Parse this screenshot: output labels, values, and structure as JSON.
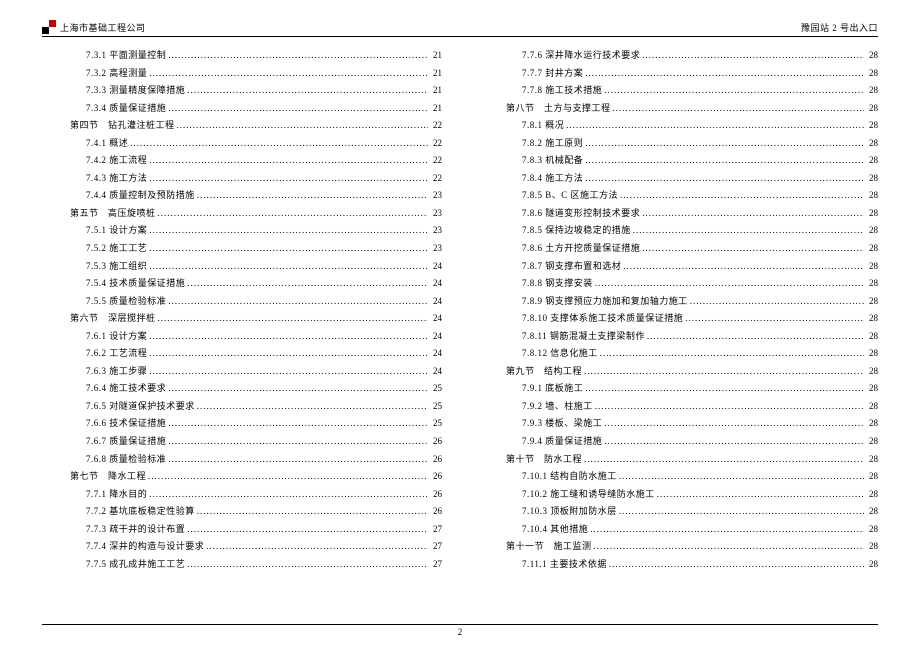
{
  "header": {
    "company": "上海市基础工程公司",
    "right": "豫园站 2 号出入口"
  },
  "footer": {
    "page_number": "2"
  },
  "toc": {
    "left": [
      {
        "indent": 1,
        "label": "7.3.1 平面测量控制",
        "page": "21"
      },
      {
        "indent": 1,
        "label": "7.3.2 高程测量",
        "page": "21"
      },
      {
        "indent": 1,
        "label": "7.3.3 测量精度保障措施",
        "page": "21"
      },
      {
        "indent": 1,
        "label": "7.3.4 质量保证措施",
        "page": "21"
      },
      {
        "indent": 0,
        "label": "第四节　钻孔灌注桩工程",
        "page": "22"
      },
      {
        "indent": 1,
        "label": "7.4.1 概述",
        "page": "22"
      },
      {
        "indent": 1,
        "label": "7.4.2 施工流程",
        "page": "22"
      },
      {
        "indent": 1,
        "label": "7.4.3 施工方法",
        "page": "22"
      },
      {
        "indent": 1,
        "label": "7.4.4 质量控制及预防措施",
        "page": "23"
      },
      {
        "indent": 0,
        "label": "第五节　高压旋喷桩",
        "page": "23"
      },
      {
        "indent": 1,
        "label": "7.5.1 设计方案",
        "page": "23"
      },
      {
        "indent": 1,
        "label": "7.5.2 施工工艺",
        "page": "23"
      },
      {
        "indent": 1,
        "label": "7.5.3 施工组织",
        "page": "24"
      },
      {
        "indent": 1,
        "label": "7.5.4 技术质量保证措施",
        "page": "24"
      },
      {
        "indent": 1,
        "label": "7.5.5 质量检验标准",
        "page": "24"
      },
      {
        "indent": 0,
        "label": "第六节　深层搅拌桩",
        "page": "24"
      },
      {
        "indent": 1,
        "label": "7.6.1 设计方案",
        "page": "24"
      },
      {
        "indent": 1,
        "label": "7.6.2 工艺流程",
        "page": "24"
      },
      {
        "indent": 1,
        "label": "7.6.3 施工步骤",
        "page": "24"
      },
      {
        "indent": 1,
        "label": "7.6.4 施工技术要求",
        "page": "25"
      },
      {
        "indent": 1,
        "label": "7.6.5 对隧道保护技术要求",
        "page": "25"
      },
      {
        "indent": 1,
        "label": "7.6.6 技术保证措施",
        "page": "25"
      },
      {
        "indent": 1,
        "label": "7.6.7 质量保证措施",
        "page": "26"
      },
      {
        "indent": 1,
        "label": "7.6.8 质量检验标准",
        "page": "26"
      },
      {
        "indent": 0,
        "label": "第七节　降水工程",
        "page": "26"
      },
      {
        "indent": 1,
        "label": "7.7.1 降水目的",
        "page": "26"
      },
      {
        "indent": 1,
        "label": "7.7.2 基坑底板稳定性验算",
        "page": "26"
      },
      {
        "indent": 1,
        "label": "7.7.3 疏干井的设计布置",
        "page": "27"
      },
      {
        "indent": 1,
        "label": "7.7.4 深井的构造与设计要求",
        "page": "27"
      },
      {
        "indent": 1,
        "label": "7.7.5 成孔成井施工工艺",
        "page": "27"
      }
    ],
    "right": [
      {
        "indent": 1,
        "label": "7.7.6 深井降水运行技术要求",
        "page": "28"
      },
      {
        "indent": 1,
        "label": "7.7.7 封井方案",
        "page": "28"
      },
      {
        "indent": 1,
        "label": "7.7.8 施工技术措施",
        "page": "28"
      },
      {
        "indent": 0,
        "label": "第八节　土方与支撑工程",
        "page": "28"
      },
      {
        "indent": 1,
        "label": "7.8.1 概况",
        "page": "28"
      },
      {
        "indent": 1,
        "label": "7.8.2 施工原则",
        "page": "28"
      },
      {
        "indent": 1,
        "label": "7.8.3 机械配备",
        "page": "28"
      },
      {
        "indent": 1,
        "label": "7.8.4 施工方法",
        "page": "28"
      },
      {
        "indent": 1,
        "label": "7.8.5 B、C 区施工方法",
        "page": "28"
      },
      {
        "indent": 1,
        "label": "7.8.6 隧道变形控制技术要求",
        "page": "28"
      },
      {
        "indent": 1,
        "label": "7.8.5 保持边坡稳定的措施",
        "page": "28"
      },
      {
        "indent": 1,
        "label": "7.8.6 土方开挖质量保证措施",
        "page": "28"
      },
      {
        "indent": 1,
        "label": "7.8.7 钢支撑布置和选材",
        "page": "28"
      },
      {
        "indent": 1,
        "label": "7.8.8 钢支撑安装",
        "page": "28"
      },
      {
        "indent": 1,
        "label": "7.8.9 钢支撑预应力施加和复加轴力施工",
        "page": "28"
      },
      {
        "indent": 1,
        "label": "7.8.10 支撑体系施工技术质量保证措施",
        "page": "28"
      },
      {
        "indent": 1,
        "label": "7.8.11 钢筋混凝土支撑梁制作",
        "page": "28"
      },
      {
        "indent": 1,
        "label": "7.8.12 信息化施工",
        "page": "28"
      },
      {
        "indent": 0,
        "label": "第九节　结构工程",
        "page": "28"
      },
      {
        "indent": 1,
        "label": "7.9.1 底板施工",
        "page": "28"
      },
      {
        "indent": 1,
        "label": "7.9.2 墙、柱施工",
        "page": "28"
      },
      {
        "indent": 1,
        "label": "7.9.3 楼板、梁施工",
        "page": "28"
      },
      {
        "indent": 1,
        "label": "7.9.4 质量保证措施",
        "page": "28"
      },
      {
        "indent": 0,
        "label": "第十节　防水工程",
        "page": "28"
      },
      {
        "indent": 1,
        "label": "7.10.1 结构自防水施工",
        "page": "28"
      },
      {
        "indent": 1,
        "label": "7.10.2 施工缝和诱导缝防水施工",
        "page": "28"
      },
      {
        "indent": 1,
        "label": "7.10.3 顶板附加防水层",
        "page": "28"
      },
      {
        "indent": 1,
        "label": "7.10.4 其他措施",
        "page": "28"
      },
      {
        "indent": 0,
        "label": "第十一节　施工监测",
        "page": "28"
      },
      {
        "indent": 1,
        "label": "7.11.1 主要技术依据",
        "page": "28"
      }
    ]
  }
}
